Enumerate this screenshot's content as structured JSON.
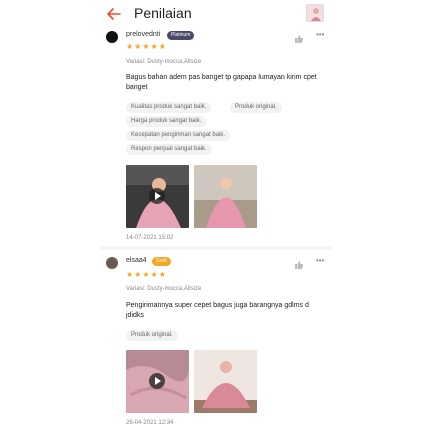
{
  "header": {
    "title": "Penilaian",
    "accent_color": "#ee4d2d",
    "back_icon": "arrow-left-icon"
  },
  "reviews": [
    {
      "username": "prelovednti",
      "badge": "Platinum",
      "badge_color": "#4a4a6a",
      "rating": 5,
      "stars": "★★★★★",
      "variation": "Variasi: Dusty-mocca,Allsize",
      "text": "Bagus bahan adem pas banget tp gapapa lumayan kirim cpet banget",
      "tags": [
        "Kualitas produk sangat baik.",
        "Produk original.",
        "Harga produk sangat baik.",
        "Kecepatan pengiriman sangat baik.",
        "Respon penjual sangat baik."
      ],
      "media": [
        "video",
        "image"
      ],
      "date": "14-07-2021 15:02"
    },
    {
      "username": "elsaa4",
      "badge": "Gold",
      "badge_color": "#f5a623",
      "rating": 5,
      "stars": "★★★★★",
      "variation": "Variasi: Dusty-mocca,Allsize",
      "text": "Pengirimannya super cepet bagus juga barangnya gdlms d jdidks",
      "tags": [
        "Produk original."
      ],
      "media": [
        "video",
        "image"
      ],
      "date": "26-04-2021 12:34"
    }
  ]
}
